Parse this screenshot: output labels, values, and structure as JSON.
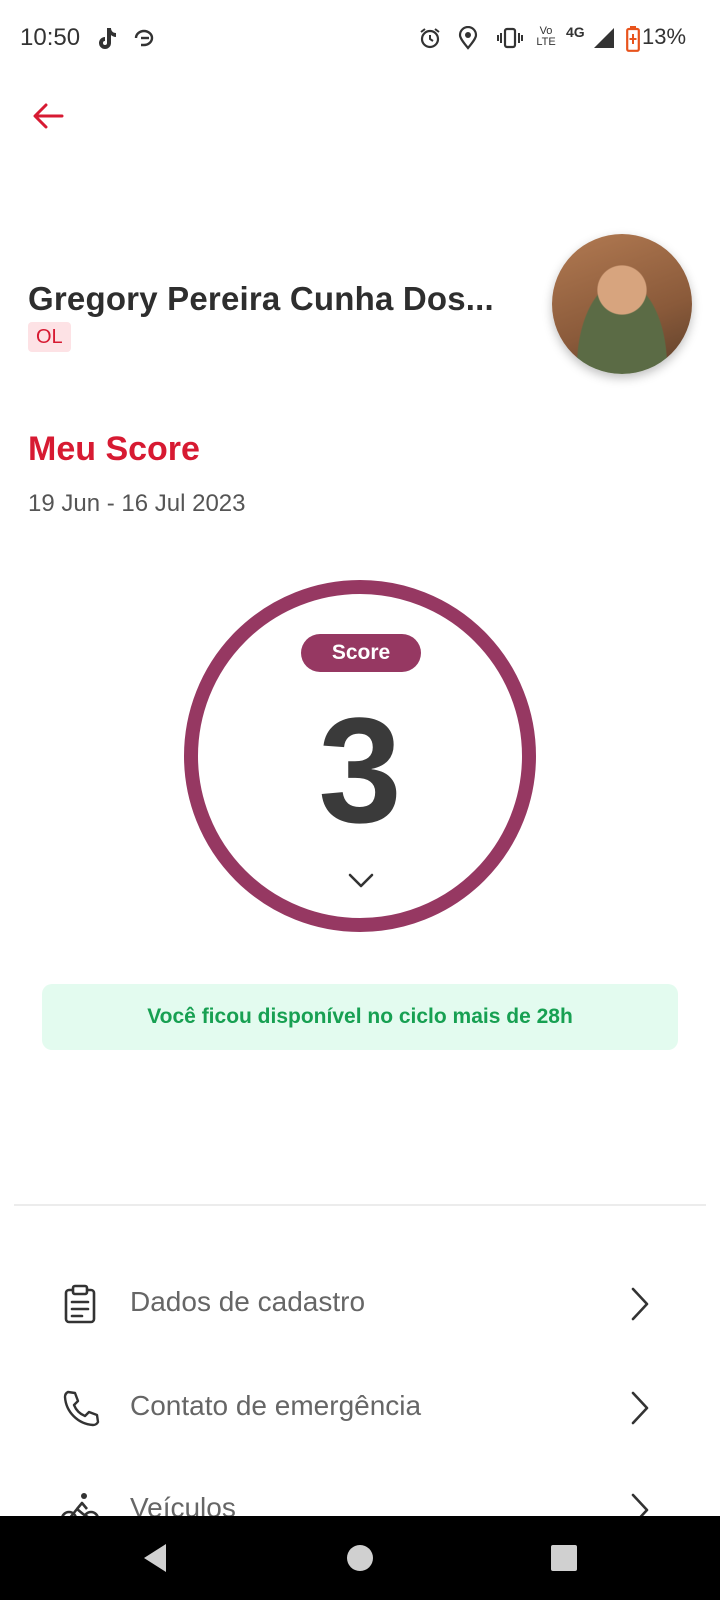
{
  "status_bar": {
    "time": "10:50",
    "network": "4G",
    "volte": "Vo LTE",
    "battery": "13%",
    "icons": [
      "tiktok-icon",
      "loop-icon",
      "alarm-icon",
      "location-icon",
      "vibrate-icon",
      "volte-icon",
      "signal-icon",
      "battery-icon"
    ]
  },
  "header": {
    "back_icon": "arrow-left-icon"
  },
  "profile": {
    "name": "Gregory Pereira Cunha Dos...",
    "badge": "OL"
  },
  "score": {
    "title": "Meu Score",
    "range": "19 Jun - 16 Jul 2023",
    "pill": "Score",
    "value": "3"
  },
  "info_message": "Você ficou disponível no ciclo mais de 28h",
  "menu": {
    "items": [
      {
        "label": "Dados de cadastro",
        "icon": "clipboard-icon"
      },
      {
        "label": "Contato de emergência",
        "icon": "phone-icon"
      },
      {
        "label": "Veículos",
        "icon": "bicycle-icon"
      }
    ]
  },
  "colors": {
    "accent_red": "#d71a32",
    "score_purple": "#963862",
    "info_green": "#17a052",
    "info_bg": "#e3fbef"
  }
}
